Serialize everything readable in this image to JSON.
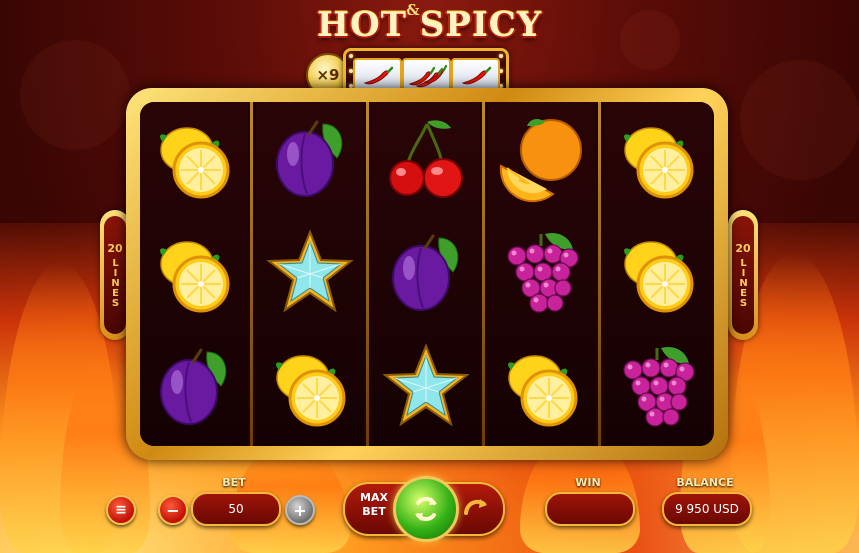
{
  "title": {
    "main": "HOT SPICY",
    "ampersand": "&"
  },
  "multiplier": {
    "label": "×9",
    "symbols": [
      "chili-icon",
      "chilis-icon",
      "chili-icon"
    ]
  },
  "lines_badge": {
    "count": "20",
    "word": "LINES"
  },
  "reels": [
    [
      "lemon",
      "lemon",
      "plum"
    ],
    [
      "plum",
      "star",
      "lemon"
    ],
    [
      "cherries",
      "plum",
      "star"
    ],
    [
      "orange",
      "grapes",
      "lemon"
    ],
    [
      "lemon",
      "lemon",
      "grapes"
    ]
  ],
  "controls": {
    "menu_label": "≡",
    "bet_label": "BET",
    "bet_value": "50",
    "minus_label": "−",
    "plus_label": "+",
    "max_bet_line1": "MAX",
    "max_bet_line2": "BET",
    "win_label": "WIN",
    "win_value": "",
    "balance_label": "BALANCE",
    "balance_value": "9 950 USD"
  },
  "colors": {
    "gold": "#f3b83a",
    "red": "#9e1408",
    "spin_green": "#35b216"
  }
}
